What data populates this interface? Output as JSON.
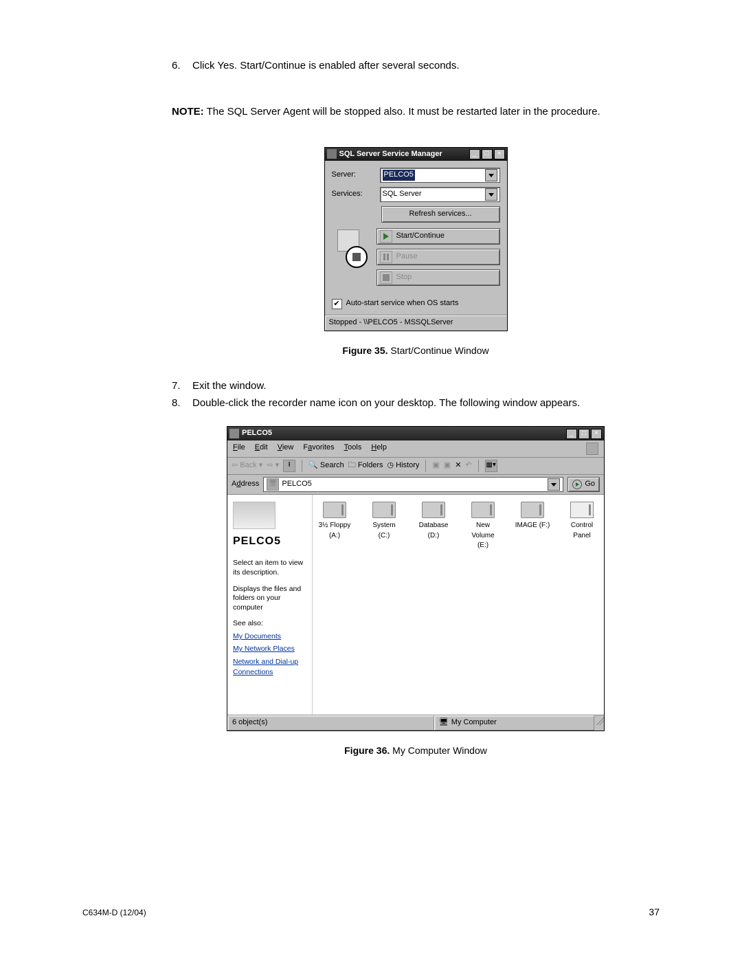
{
  "steps": {
    "6": {
      "num": "6.",
      "text": "Click Yes. Start/Continue is enabled after several seconds."
    },
    "7": {
      "num": "7.",
      "text": "Exit the window."
    },
    "8": {
      "num": "8.",
      "text": "Double-click the recorder name icon on your desktop. The following window appears."
    }
  },
  "note": {
    "label": "NOTE:",
    "text": "  The SQL Server Agent will be stopped also. It must be restarted later in the procedure."
  },
  "fig35": {
    "bold": "Figure 35.",
    "text": "  Start/Continue Window"
  },
  "fig36": {
    "bold": "Figure 36.",
    "text": "  My Computer Window"
  },
  "sql": {
    "title": "SQL Server Service Manager",
    "server_label": "Server:",
    "server_value": "PELCO5",
    "services_label": "Services:",
    "services_value": "SQL Server",
    "refresh": "Refresh services...",
    "start": "Start/Continue",
    "pause": "Pause",
    "stop": "Stop",
    "autostart": "Auto-start service when OS starts",
    "checked": "✔",
    "status": "Stopped - \\\\PELCO5 - MSSQLServer"
  },
  "explorer": {
    "title": "PELCO5",
    "menu": {
      "file": "File",
      "edit": "Edit",
      "view": "View",
      "favorites": "Favorites",
      "tools": "Tools",
      "help": "Help"
    },
    "toolbar": {
      "back": "Back",
      "search": "Search",
      "folders": "Folders",
      "history": "History",
      "go": "Go"
    },
    "addr_label": "Address",
    "addr_value": "PELCO5",
    "side": {
      "heading": "PELCO5",
      "hint": "Select an item to view its description.",
      "desc": "Displays the files and folders on your computer",
      "seealso": "See also:",
      "link1": "My Documents",
      "link2": "My Network Places",
      "link3": "Network and Dial-up Connections"
    },
    "drives": {
      "a": "3½ Floppy (A:)",
      "c": "System (C:)",
      "d": "Database (D:)",
      "e": "New Volume (E:)",
      "f": "IMAGE (F:)",
      "cp": "Control Panel"
    },
    "status_left": "6 object(s)",
    "status_right": "My Computer"
  },
  "footer": {
    "left": "C634M-D (12/04)",
    "right": "37"
  }
}
